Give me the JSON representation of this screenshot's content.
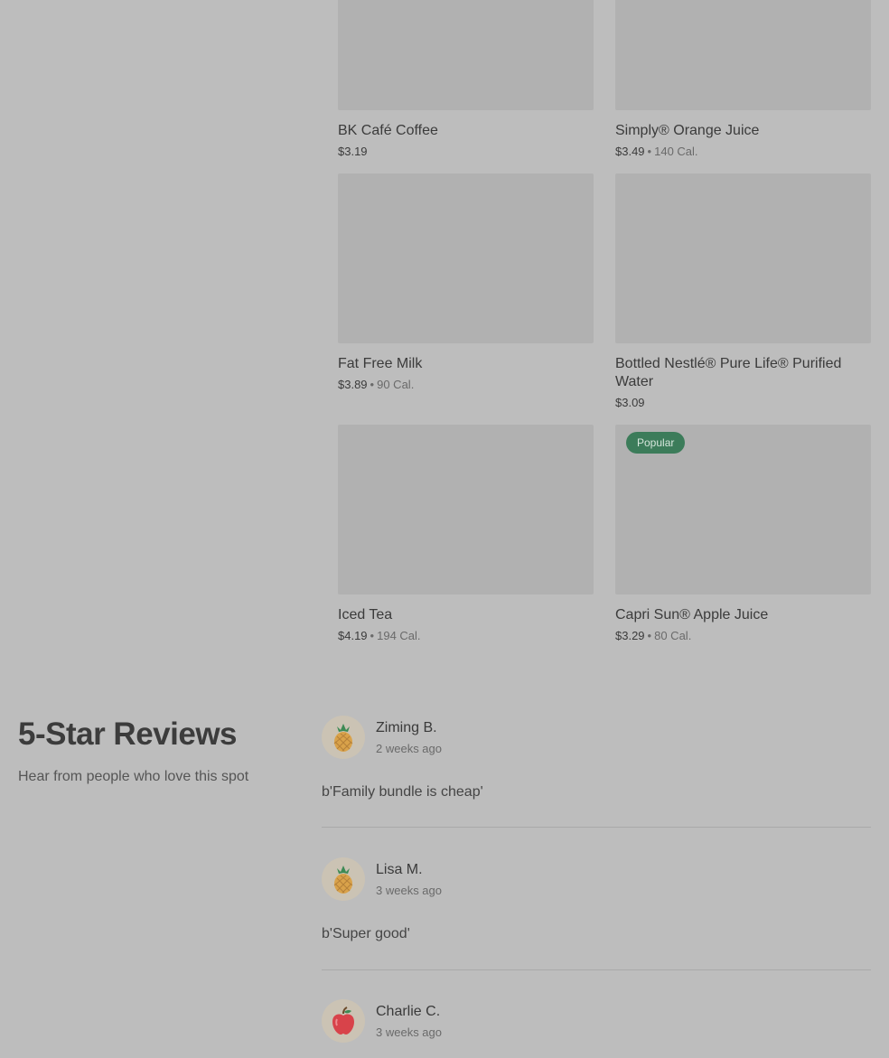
{
  "products": [
    {
      "name": "BK Café Coffee",
      "price": "$3.19",
      "cal": ""
    },
    {
      "name": "Simply® Orange Juice",
      "price": "$3.49",
      "cal": "140 Cal."
    },
    {
      "name": "Fat Free Milk",
      "price": "$3.89",
      "cal": "90 Cal."
    },
    {
      "name": "Bottled Nestlé® Pure Life® Purified Water",
      "price": "$3.09",
      "cal": ""
    },
    {
      "name": "Iced Tea",
      "price": "$4.19",
      "cal": "194 Cal."
    },
    {
      "name": "Capri Sun® Apple Juice",
      "price": "$3.29",
      "cal": "80 Cal.",
      "badge": "Popular"
    }
  ],
  "separator": "•",
  "reviews_section": {
    "title": "5-Star Reviews",
    "subtitle": "Hear from people who love this spot"
  },
  "reviews": [
    {
      "name": "Ziming B.",
      "when": "2 weeks ago",
      "text": "b'Family bundle is cheap'",
      "avatar_icon": "pineapple-icon"
    },
    {
      "name": "Lisa M.",
      "when": "3 weeks ago",
      "text": "b'Super good'",
      "avatar_icon": "pineapple-icon"
    },
    {
      "name": "Charlie C.",
      "when": "3 weeks ago",
      "text": "",
      "avatar_icon": "apple-icon"
    }
  ],
  "colors": {
    "badge_bg": "#3c7c5a",
    "background": "#bdbdbd",
    "placeholder": "#b1b1b1"
  }
}
